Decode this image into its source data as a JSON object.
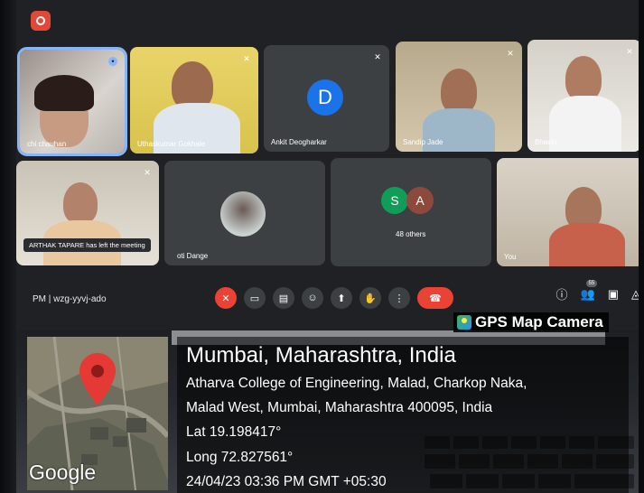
{
  "meet": {
    "meeting_info": "PM  |  wzg-yyvj-ado",
    "notification": "ARTHAK TAPARE has left the meeting",
    "participant_count_badge": "55",
    "tiles": [
      {
        "name": "chi chauhan"
      },
      {
        "name": "Uthaskumar Gokhale"
      },
      {
        "name": "Ankit Deogharkar",
        "initial": "D"
      },
      {
        "name": "Sandip Jade"
      },
      {
        "name": "Bhavin"
      },
      {
        "name": ""
      },
      {
        "name": "oti Dange"
      },
      {
        "name": "48 others",
        "initials": [
          "S",
          "A"
        ]
      },
      {
        "name": "You"
      }
    ],
    "colors": {
      "active_border": "#8ab4f8",
      "end_call": "#ea4335",
      "avatar_d": "#1a73e8",
      "avatar_s": "#0f9d58",
      "avatar_a": "#8d4a3c"
    }
  },
  "gps": {
    "app_label": "GPS Map Camera",
    "map_brand": "Google",
    "title": "Mumbai, Maharashtra, India",
    "address_line1": "Atharva College of Engineering, Malad, Charkop Naka,",
    "address_line2": "Malad West, Mumbai, Maharashtra 400095, India",
    "lat": "Lat 19.198417°",
    "long": "Long 72.827561°",
    "datetime": "24/04/23 03:36 PM GMT +05:30"
  }
}
